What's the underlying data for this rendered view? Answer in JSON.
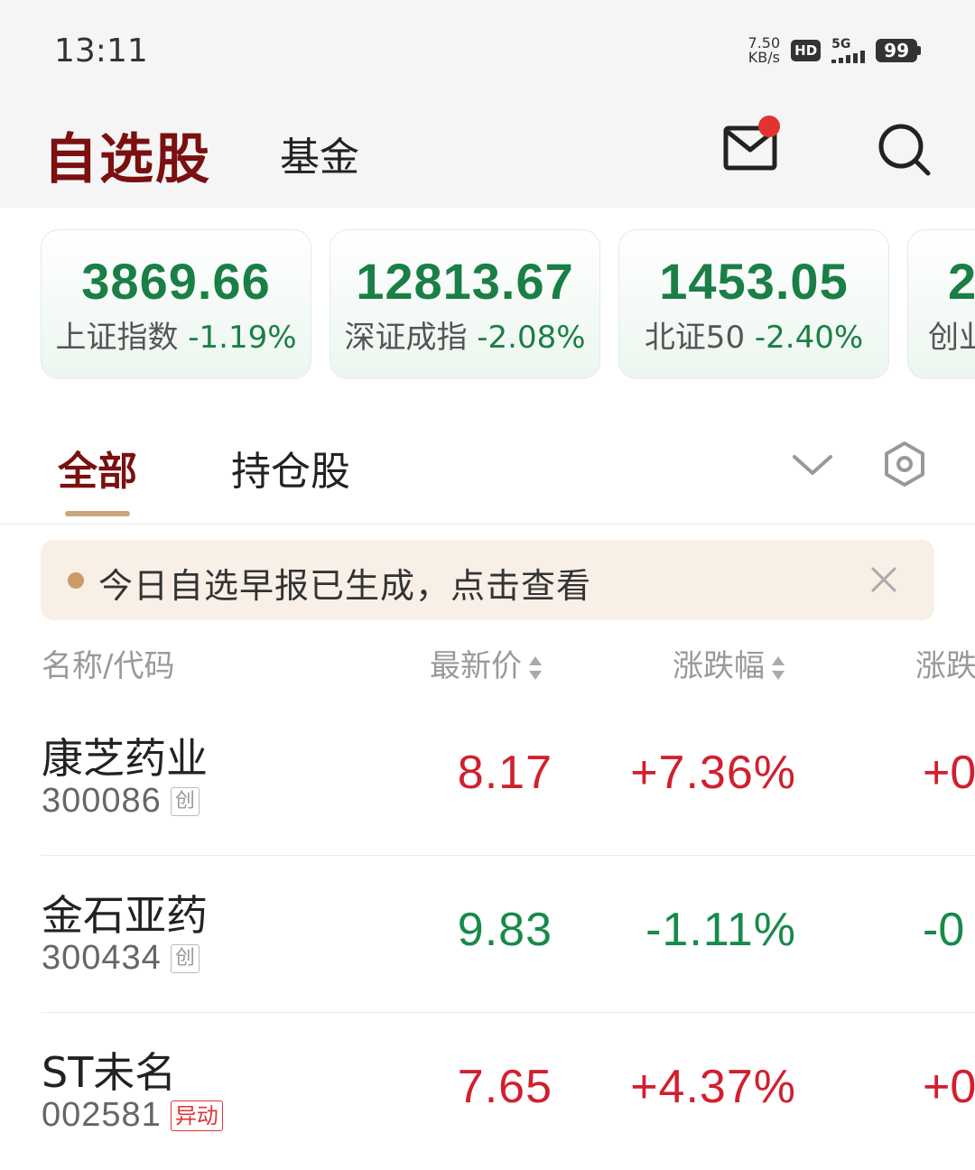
{
  "status_bar": {
    "time": "13:11",
    "net_speed_value": "7.50",
    "net_speed_unit": "KB/s",
    "hd": "HD",
    "network": "5G",
    "battery": "99"
  },
  "header": {
    "title": "自选股",
    "fund_tab": "基金",
    "icons": [
      "mail-icon",
      "search-icon"
    ]
  },
  "indices": [
    {
      "value": "3869.66",
      "name": "上证指数",
      "change": "-1.19%"
    },
    {
      "value": "12813.67",
      "name": "深证成指",
      "change": "-2.08%"
    },
    {
      "value": "1453.05",
      "name": "北证50",
      "change": "-2.40%"
    },
    {
      "value": "2",
      "name": "创业",
      "change": ""
    }
  ],
  "tabs": {
    "all": "全部",
    "holdings": "持仓股"
  },
  "banner": {
    "text": "今日自选早报已生成，点击查看"
  },
  "table": {
    "headers": {
      "name": "名称/代码",
      "price": "最新价",
      "pct": "涨跌幅",
      "chg": "涨跌"
    },
    "rows": [
      {
        "name": "康芝药业",
        "code": "300086",
        "tag": "创",
        "price": "8.17",
        "pct": "+7.36%",
        "chg": "+0",
        "trend": "up"
      },
      {
        "name": "金石亚药",
        "code": "300434",
        "tag": "创",
        "price": "9.83",
        "pct": "-1.11%",
        "chg": "-0",
        "trend": "down"
      },
      {
        "name": "ST未名",
        "code": "002581",
        "tag": "异动",
        "price": "7.65",
        "pct": "+4.37%",
        "chg": "+0",
        "trend": "up"
      }
    ]
  },
  "colors": {
    "brand": "#7a1010",
    "up": "#d21f2e",
    "down": "#178a4a",
    "accent": "#c9a77b"
  }
}
